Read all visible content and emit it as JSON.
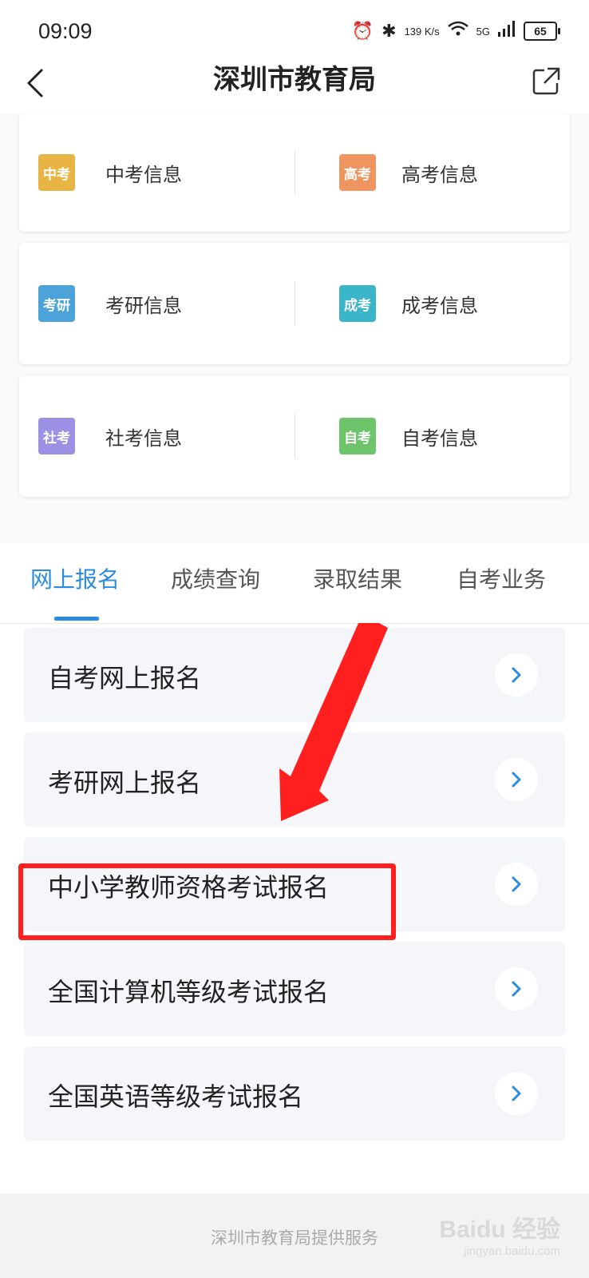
{
  "status_bar": {
    "time": "09:09",
    "network_speed": "139 K/s",
    "signal": "5G",
    "battery": "65"
  },
  "nav": {
    "title": "深圳市教育局",
    "back_icon": "chevron-left-icon",
    "share_icon": "share-icon"
  },
  "exam_categories": [
    {
      "left": {
        "badge": "中考",
        "label": "中考信息",
        "color": "#e8b443"
      },
      "right": {
        "badge": "高考",
        "label": "高考信息",
        "color": "#ef9560"
      }
    },
    {
      "left": {
        "badge": "考研",
        "label": "考研信息",
        "color": "#4ca3d9"
      },
      "right": {
        "badge": "成考",
        "label": "成考信息",
        "color": "#3bb5c9"
      }
    },
    {
      "left": {
        "badge": "社考",
        "label": "社考信息",
        "color": "#9a91e4"
      },
      "right": {
        "badge": "自考",
        "label": "自考信息",
        "color": "#6ec46b"
      }
    }
  ],
  "tabs": [
    "网上报名",
    "成绩查询",
    "录取结果",
    "自考业务"
  ],
  "active_tab": "网上报名",
  "registration_items": [
    "自考网上报名",
    "考研网上报名",
    "中小学教师资格考试报名",
    "全国计算机等级考试报名",
    "全国英语等级考试报名"
  ],
  "highlighted_item": "中小学教师资格考试报名",
  "footer": {
    "text": "深圳市教育局提供服务",
    "watermark": "Baidu 经验",
    "watermark_sub": "jingyan.baidu.com"
  },
  "colors": {
    "accent": "#2a8ce0",
    "highlight": "#ff1f1f"
  }
}
